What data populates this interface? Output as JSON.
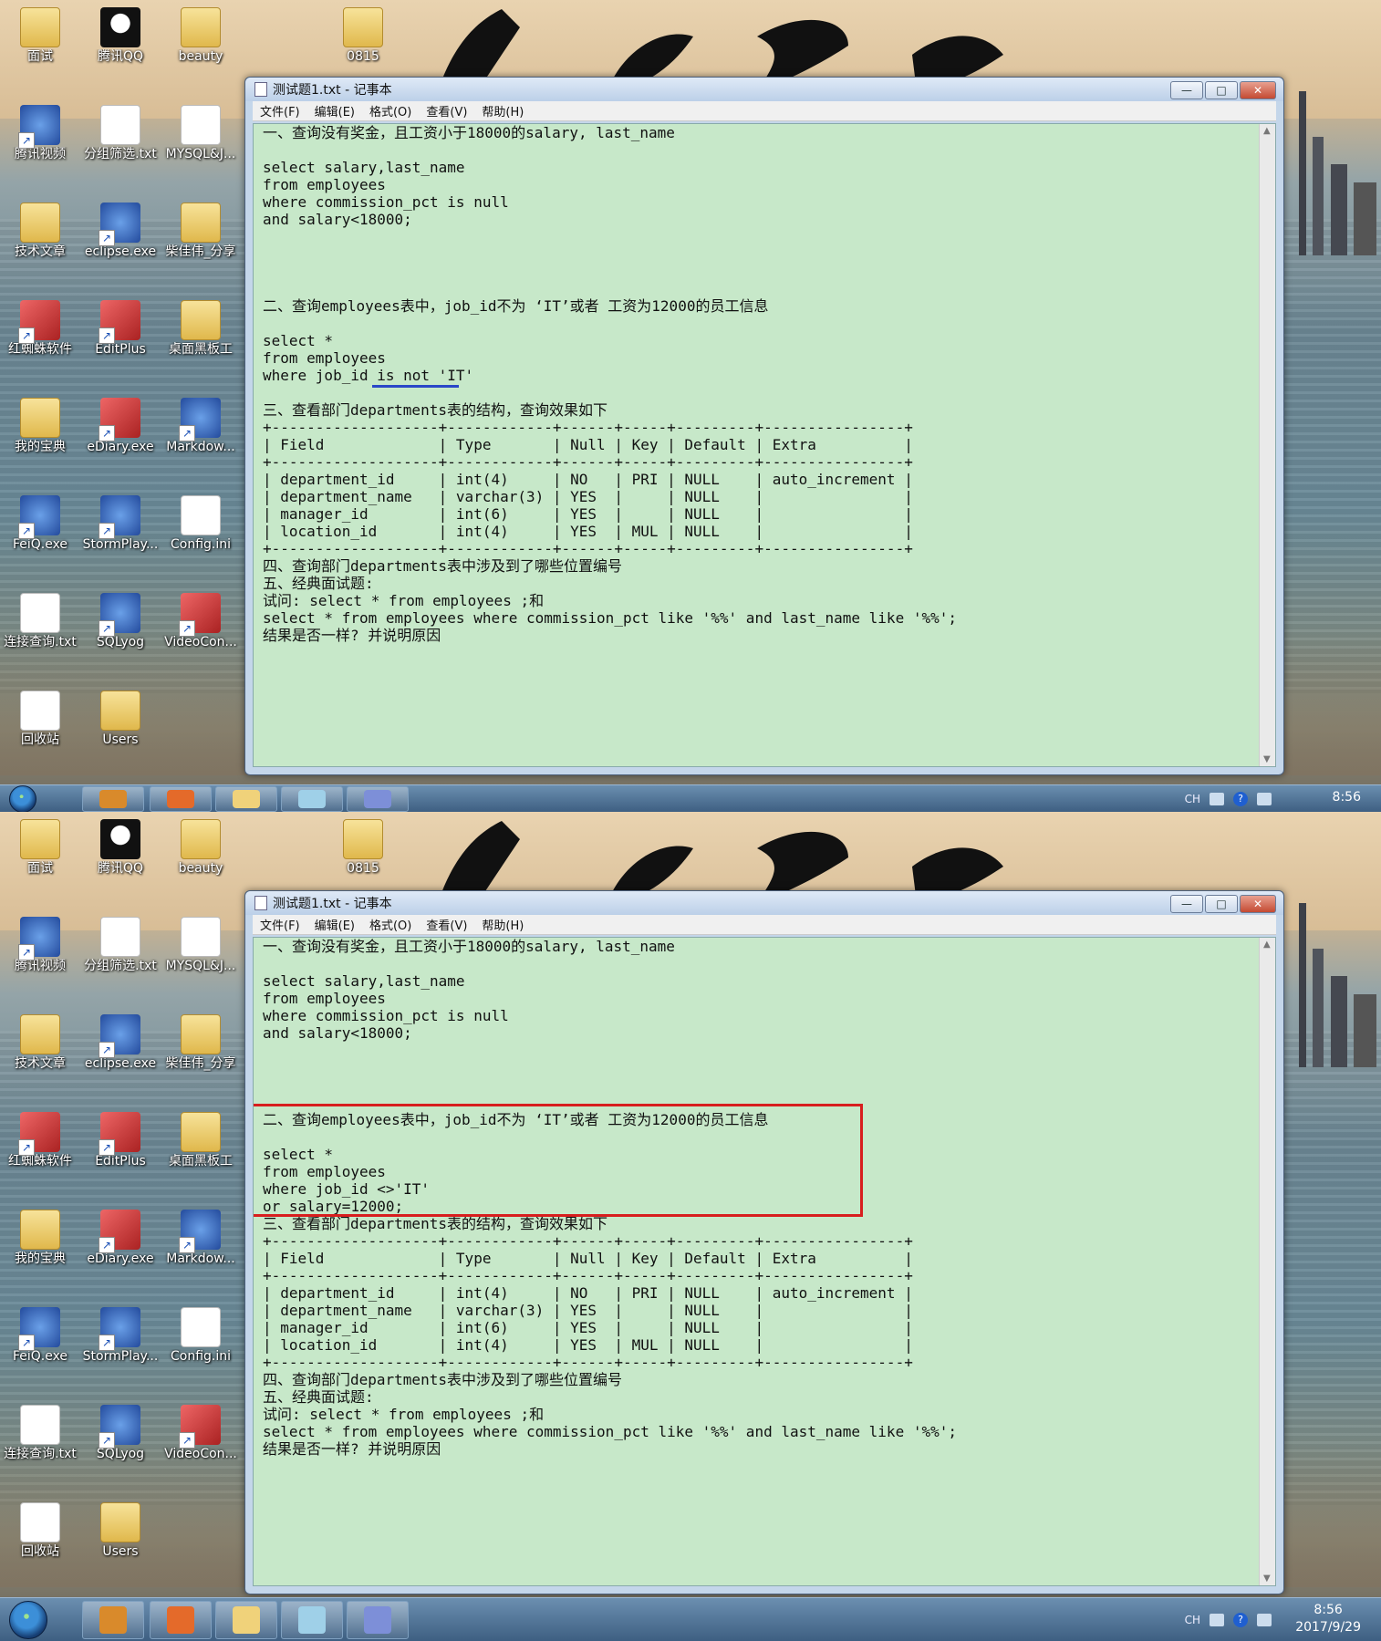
{
  "desktop_icons": [
    {
      "label": "面试",
      "kind": "folder"
    },
    {
      "label": "腾讯QQ",
      "kind": "qq"
    },
    {
      "label": "beauty",
      "kind": "folder"
    },
    {
      "label": "0815",
      "kind": "folder"
    },
    {
      "label": "腾讯视频",
      "kind": "exe"
    },
    {
      "label": "分组筛选.txt",
      "kind": "doc"
    },
    {
      "label": "MYSQL&J...",
      "kind": "doc"
    },
    {
      "label": "技术文章",
      "kind": "folder"
    },
    {
      "label": "eclipse.exe",
      "kind": "exe"
    },
    {
      "label": "柴佳伟_分享",
      "kind": "folder"
    },
    {
      "label": "红蜘蛛软件",
      "kind": "app"
    },
    {
      "label": "EditPlus",
      "kind": "app"
    },
    {
      "label": "桌面黑板工",
      "kind": "folder"
    },
    {
      "label": "我的宝典",
      "kind": "folder"
    },
    {
      "label": "eDiary.exe",
      "kind": "app"
    },
    {
      "label": "Markdow...",
      "kind": "exe"
    },
    {
      "label": "FeiQ.exe",
      "kind": "exe"
    },
    {
      "label": "StormPlay...",
      "kind": "exe"
    },
    {
      "label": "Config.ini",
      "kind": "doc"
    },
    {
      "label": "连接查询.txt",
      "kind": "doc"
    },
    {
      "label": "SQLyog",
      "kind": "exe"
    },
    {
      "label": "VideoCon...",
      "kind": "app"
    },
    {
      "label": "回收站",
      "kind": "doc"
    },
    {
      "label": "Users",
      "kind": "folder"
    }
  ],
  "notepad": {
    "title": "测试题1.txt - 记事本",
    "menu": [
      "文件(F)",
      "编辑(E)",
      "格式(O)",
      "查看(V)",
      "帮助(H)"
    ],
    "buttons": {
      "minimize": "—",
      "maximize": "□",
      "close": "✕"
    }
  },
  "screens": [
    {
      "text": "一、查询没有奖金，且工资小于18000的salary, last_name\n\nselect salary,last_name\nfrom employees\nwhere commission_pct is null\nand salary<18000;\n\n\n\n\n二、查询employees表中，job_id不为 ‘IT’或者 工资为12000的员工信息\n\nselect *\nfrom employees\nwhere job_id is not 'IT'\n\n三、查看部门departments表的结构，查询效果如下\n+-------------------+------------+------+-----+---------+----------------+\n| Field             | Type       | Null | Key | Default | Extra          |\n+-------------------+------------+------+-----+---------+----------------+\n| department_id     | int(4)     | NO   | PRI | NULL    | auto_increment |\n| department_name   | varchar(3) | YES  |     | NULL    |                |\n| manager_id        | int(6)     | YES  |     | NULL    |                |\n| location_id       | int(4)     | YES  | MUL | NULL    |                |\n+-------------------+------------+------+-----+---------+----------------+\n四、查询部门departments表中涉及到了哪些位置编号\n五、经典面试题:\n试问: select * from employees ;和\nselect * from employees where commission_pct like '%%' and last_name like '%%';\n结果是否一样? 并说明原因",
      "clock_time": "8:56",
      "clock_date": ""
    },
    {
      "text": "一、查询没有奖金，且工资小于18000的salary, last_name\n\nselect salary,last_name\nfrom employees\nwhere commission_pct is null\nand salary<18000;\n\n\n\n\n二、查询employees表中，job_id不为 ‘IT’或者 工资为12000的员工信息\n\nselect *\nfrom employees\nwhere job_id <>'IT'\nor salary=12000;\n三、查看部门departments表的结构，查询效果如下\n+-------------------+------------+------+-----+---------+----------------+\n| Field             | Type       | Null | Key | Default | Extra          |\n+-------------------+------------+------+-----+---------+----------------+\n| department_id     | int(4)     | NO   | PRI | NULL    | auto_increment |\n| department_name   | varchar(3) | YES  |     | NULL    |                |\n| manager_id        | int(6)     | YES  |     | NULL    |                |\n| location_id       | int(4)     | YES  | MUL | NULL    |                |\n+-------------------+------------+------+-----+---------+----------------+\n四、查询部门departments表中涉及到了哪些位置编号\n五、经典面试题:\n试问: select * from employees ;和\nselect * from employees where commission_pct like '%%' and last_name like '%%';\n结果是否一样? 并说明原因",
      "clock_time": "8:56",
      "clock_date": "2017/9/29"
    }
  ],
  "tray": {
    "lang": "CH",
    "help": "?"
  },
  "colors": {
    "editor_bg": "#c7e8c9",
    "highlight_box": "#d81e1e",
    "underline": "#2a47c8"
  }
}
